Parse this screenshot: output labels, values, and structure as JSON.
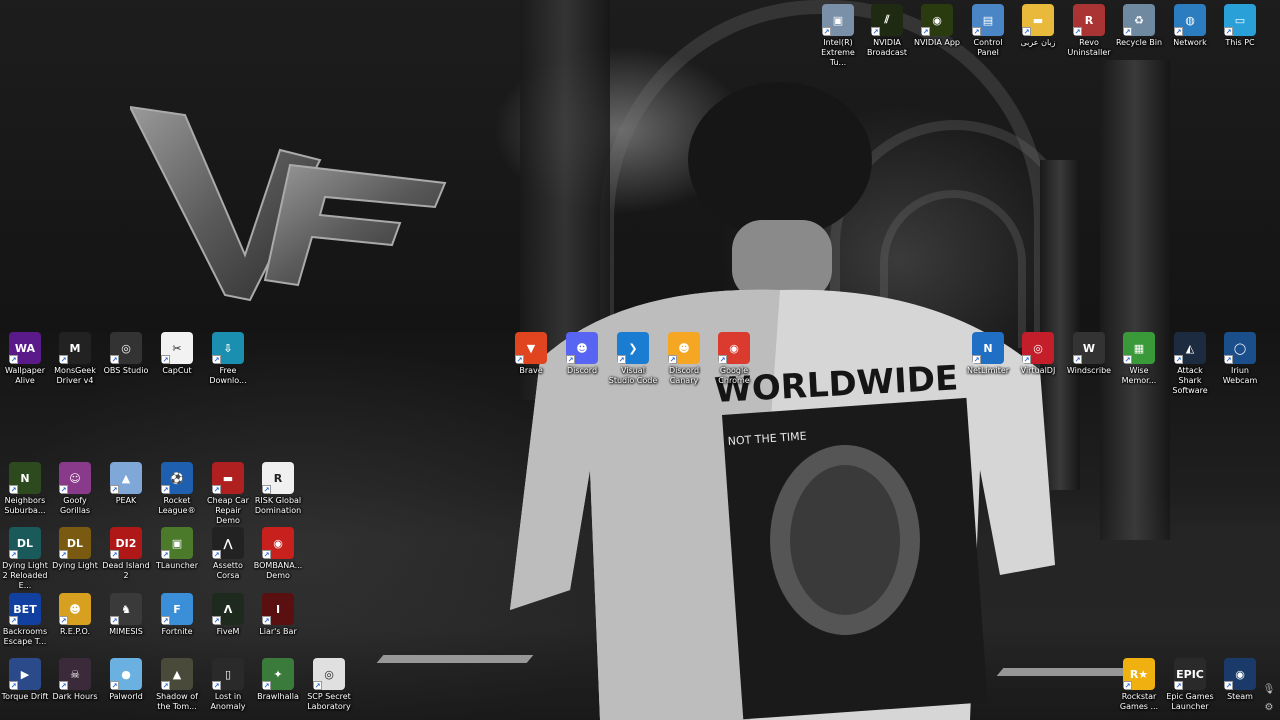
{
  "desktop": {
    "top_right": [
      {
        "label": "Intel(R) Extreme Tu...",
        "icon": "intel-xtu-icon",
        "bg": "#7a8fa8",
        "glyph": "▣"
      },
      {
        "label": "NVIDIA Broadcast",
        "icon": "nvidia-broadcast-icon",
        "bg": "#1f2a12",
        "glyph": "⫽"
      },
      {
        "label": "NVIDIA App",
        "icon": "nvidia-app-icon",
        "bg": "#2b3b10",
        "glyph": "◉"
      },
      {
        "label": "Control Panel",
        "icon": "control-panel-icon",
        "bg": "#4a86c5",
        "glyph": "▤"
      },
      {
        "label": "زبان عربی",
        "icon": "folder-icon",
        "bg": "#e8b93b",
        "glyph": "▬"
      },
      {
        "label": "Revo Uninstaller",
        "icon": "revo-uninstaller-icon",
        "bg": "#a33",
        "glyph": "R"
      },
      {
        "label": "Recycle Bin",
        "icon": "recycle-bin-icon",
        "bg": "#6f8aa0",
        "glyph": "♻"
      },
      {
        "label": "Network",
        "icon": "network-icon",
        "bg": "#2c7dbf",
        "glyph": "◍"
      },
      {
        "label": "This PC",
        "icon": "this-pc-icon",
        "bg": "#2aa0d8",
        "glyph": "▭"
      }
    ],
    "left_row1": [
      {
        "label": "Wallpaper Alive",
        "icon": "wallpaper-alive-icon",
        "bg": "#5a1a8a",
        "glyph": "WA"
      },
      {
        "label": "MonsGeek Driver v4",
        "icon": "monsgeek-icon",
        "bg": "#222",
        "glyph": "M"
      },
      {
        "label": "OBS Studio",
        "icon": "obs-studio-icon",
        "bg": "#333",
        "glyph": "◎"
      },
      {
        "label": "CapCut",
        "icon": "capcut-icon",
        "bg": "#f2f2f2",
        "glyph": "✂"
      },
      {
        "label": "Free Downlo...",
        "icon": "free-download-icon",
        "bg": "#1b8fb0",
        "glyph": "⇩"
      }
    ],
    "middle_row": [
      {
        "label": "Brave",
        "icon": "brave-icon",
        "bg": "#e1451f",
        "glyph": "▼"
      },
      {
        "label": "Discord",
        "icon": "discord-icon",
        "bg": "#5865f2",
        "glyph": "☻"
      },
      {
        "label": "Visual Studio Code",
        "icon": "vscode-icon",
        "bg": "#1b7dd1",
        "glyph": "❯"
      },
      {
        "label": "Discord Canary",
        "icon": "discord-canary-icon",
        "bg": "#f5a623",
        "glyph": "☻"
      },
      {
        "label": "Google Chrome",
        "icon": "chrome-icon",
        "bg": "#db3a2e",
        "glyph": "◉"
      }
    ],
    "right_row": [
      {
        "label": "NetLimiter",
        "icon": "netlimiter-icon",
        "bg": "#1f6fc4",
        "glyph": "N"
      },
      {
        "label": "VirtualDJ",
        "icon": "virtualdj-icon",
        "bg": "#c41e2a",
        "glyph": "◎"
      },
      {
        "label": "Windscribe",
        "icon": "windscribe-icon",
        "bg": "#333",
        "glyph": "W"
      },
      {
        "label": "Wise Memor...",
        "icon": "wise-memory-icon",
        "bg": "#3a9a3a",
        "glyph": "▦"
      },
      {
        "label": "Attack Shark Software",
        "icon": "attack-shark-icon",
        "bg": "#1c2b40",
        "glyph": "◭"
      },
      {
        "label": "Iriun Webcam",
        "icon": "iriun-webcam-icon",
        "bg": "#1b4f8c",
        "glyph": "◯"
      }
    ],
    "games_row1": [
      {
        "label": "Neighbors Suburba...",
        "icon": "neighbors-icon",
        "bg": "#2d4a1e",
        "glyph": "N"
      },
      {
        "label": "Goofy Gorillas",
        "icon": "goofy-gorillas-icon",
        "bg": "#8a3a8a",
        "glyph": "☺"
      },
      {
        "label": "PEAK",
        "icon": "peak-icon",
        "bg": "#7fa8d8",
        "glyph": "▲"
      },
      {
        "label": "Rocket League®",
        "icon": "rocket-league-icon",
        "bg": "#1e5fb0",
        "glyph": "⚽"
      },
      {
        "label": "Cheap Car Repair Demo",
        "icon": "cheap-car-repair-icon",
        "bg": "#b02020",
        "glyph": "▬"
      },
      {
        "label": "RISK Global Domination",
        "icon": "risk-icon",
        "bg": "#f0f0f0",
        "glyph": "R"
      }
    ],
    "games_row2": [
      {
        "label": "Dying Light 2 Reloaded E...",
        "icon": "dying-light-2-icon",
        "bg": "#1a5a5a",
        "glyph": "DL"
      },
      {
        "label": "Dying Light",
        "icon": "dying-light-icon",
        "bg": "#7a5a10",
        "glyph": "DL"
      },
      {
        "label": "Dead Island 2",
        "icon": "dead-island-2-icon",
        "bg": "#b01818",
        "glyph": "DI2"
      },
      {
        "label": "TLauncher",
        "icon": "tlauncher-icon",
        "bg": "#4a7a2a",
        "glyph": "▣"
      },
      {
        "label": "Assetto Corsa",
        "icon": "assetto-corsa-icon",
        "bg": "#222",
        "glyph": "⋀"
      },
      {
        "label": "BOMBANA... Demo",
        "icon": "bombana-icon",
        "bg": "#c8201c",
        "glyph": "◉"
      }
    ],
    "games_row3": [
      {
        "label": "Backrooms Escape T...",
        "icon": "backrooms-icon",
        "bg": "#1240a0",
        "glyph": "BET"
      },
      {
        "label": "R.E.P.O.",
        "icon": "repo-icon",
        "bg": "#d8a020",
        "glyph": "☻"
      },
      {
        "label": "MIMESIS",
        "icon": "mimesis-icon",
        "bg": "#3a3a3a",
        "glyph": "♞"
      },
      {
        "label": "Fortnite",
        "icon": "fortnite-icon",
        "bg": "#3a8fd8",
        "glyph": "F"
      },
      {
        "label": "FiveM",
        "icon": "fivem-icon",
        "bg": "#1f2a1f",
        "glyph": "Λ"
      },
      {
        "label": "Liar's Bar",
        "icon": "liars-bar-icon",
        "bg": "#5a1010",
        "glyph": "I"
      }
    ],
    "games_row4": [
      {
        "label": "Torque Drift",
        "icon": "torque-drift-icon",
        "bg": "#2a4a8a",
        "glyph": "▶"
      },
      {
        "label": "Dark Hours",
        "icon": "dark-hours-icon",
        "bg": "#3a2a3a",
        "glyph": "☠"
      },
      {
        "label": "Palworld",
        "icon": "palworld-icon",
        "bg": "#6ab0e0",
        "glyph": "●"
      },
      {
        "label": "Shadow of the Tom...",
        "icon": "shadow-tomb-raider-icon",
        "bg": "#4a4a3a",
        "glyph": "▲"
      },
      {
        "label": "Lost in Anomaly",
        "icon": "lost-in-anomaly-icon",
        "bg": "#2a2a2a",
        "glyph": "▯"
      },
      {
        "label": "Brawlhalla",
        "icon": "brawlhalla-icon",
        "bg": "#3a7a3a",
        "glyph": "✦"
      },
      {
        "label": "SCP Secret Laboratory",
        "icon": "scp-icon",
        "bg": "#e0e0e0",
        "glyph": "◎"
      }
    ],
    "bottom_right": [
      {
        "label": "Rockstar Games ...",
        "icon": "rockstar-icon",
        "bg": "#f0b010",
        "glyph": "R★"
      },
      {
        "label": "Epic Games Launcher",
        "icon": "epic-games-icon",
        "bg": "#2a2a2a",
        "glyph": "EPIC"
      },
      {
        "label": "Steam",
        "icon": "steam-icon",
        "bg": "#1a3a6a",
        "glyph": "◉"
      }
    ]
  },
  "wallpaper": {
    "logo_text": "VF",
    "shirt_brand": "WORLDWIDE",
    "shirt_caption": "NOT THE TIME"
  },
  "tray": [
    {
      "icon": "microphone-icon",
      "glyph": "🎙"
    },
    {
      "icon": "settings-gear-icon",
      "glyph": "⚙"
    }
  ]
}
